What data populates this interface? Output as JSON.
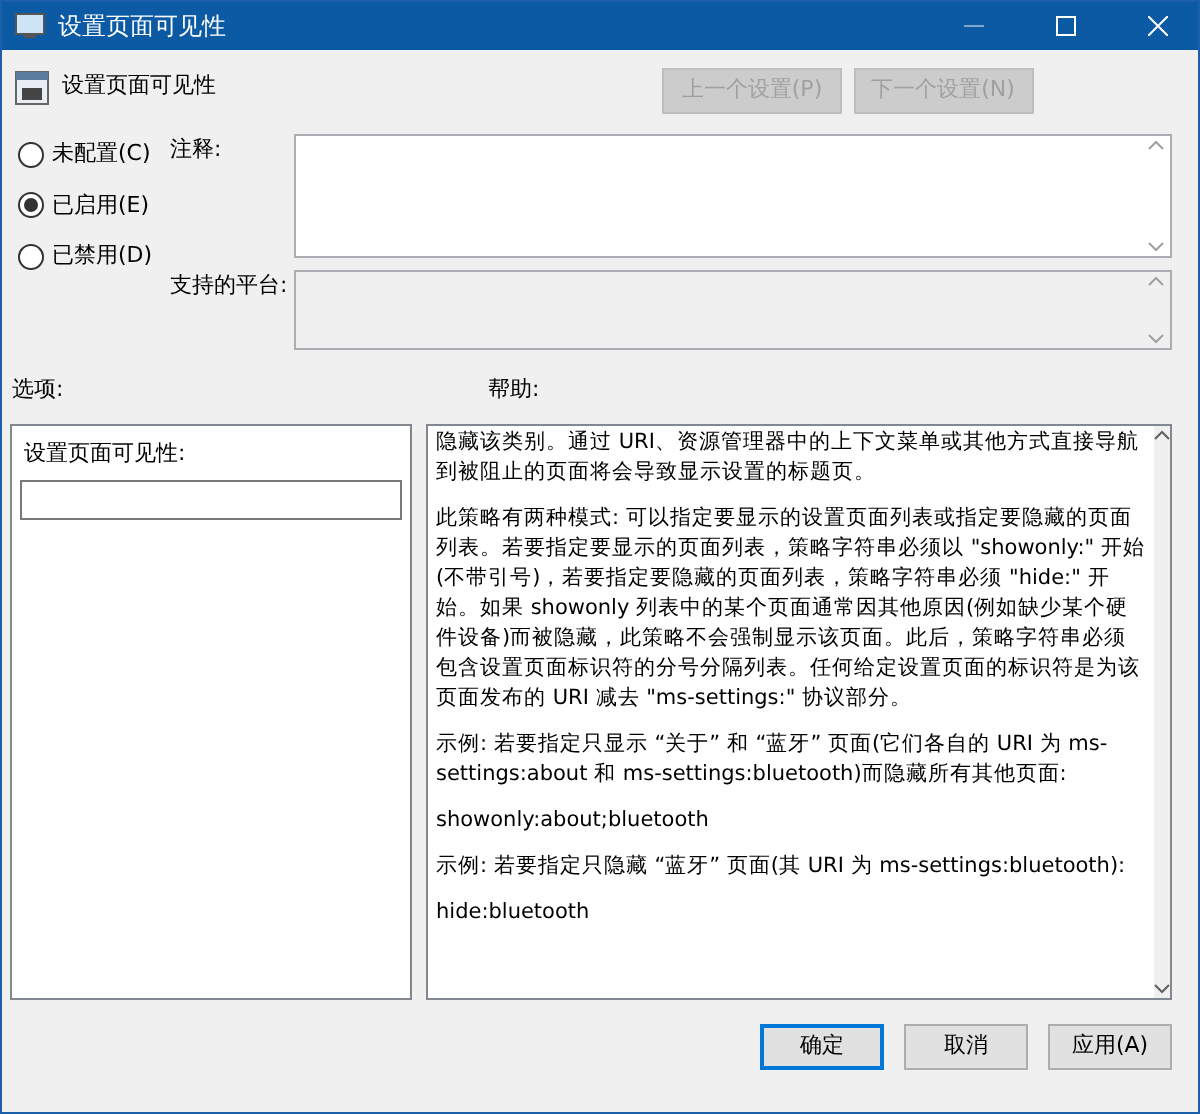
{
  "window": {
    "title": "设置页面可见性"
  },
  "policy": {
    "title": "设置页面可见性"
  },
  "nav_buttons": [
    {
      "label": "上一个设置(P)",
      "disabled": true
    },
    {
      "label": "下一个设置(N)",
      "disabled": true
    }
  ],
  "states": [
    {
      "label": "未配置(C)",
      "selected": false
    },
    {
      "label": "已启用(E)",
      "selected": true
    },
    {
      "label": "已禁用(D)",
      "selected": false
    }
  ],
  "comment": {
    "label": "注释:"
  },
  "platform": {
    "label": "支持的平台:"
  },
  "options": {
    "heading": "选项:",
    "field_label": "设置页面可见性:"
  },
  "help": {
    "heading": "帮助:",
    "paragraphs": [
      "隐藏该类别。通过 URI、资源管理器中的上下文菜单或其他方式直接导航到被阻止的页面将会导致显示设置的标题页。",
      "此策略有两种模式: 可以指定要显示的设置页面列表或指定要隐藏的页面列表。若要指定要显示的页面列表，策略字符串必须以 \"showonly:\" 开始(不带引号)，若要指定要隐藏的页面列表，策略字符串必须 \"hide:\" 开始。如果 showonly 列表中的某个页面通常因其他原因(例如缺少某个硬件设备)而被隐藏，此策略不会强制显示该页面。此后，策略字符串必须包含设置页面标识符的分号分隔列表。任何给定设置页面的标识符是为该页面发布的 URI 减去 \"ms-settings:\" 协议部分。",
      "示例: 若要指定只显示 “关于” 和 “蓝牙” 页面(它们各自的 URI 为 ms-settings:about 和 ms-settings:bluetooth)而隐藏所有其他页面:",
      "showonly:about;bluetooth",
      "示例: 若要指定只隐藏 “蓝牙” 页面(其 URI 为 ms-settings:bluetooth):",
      "hide:bluetooth"
    ]
  },
  "footer_buttons": [
    {
      "label": "确定",
      "default": true
    },
    {
      "label": "取消",
      "default": false
    },
    {
      "label": "应用(A)",
      "default": false
    }
  ]
}
